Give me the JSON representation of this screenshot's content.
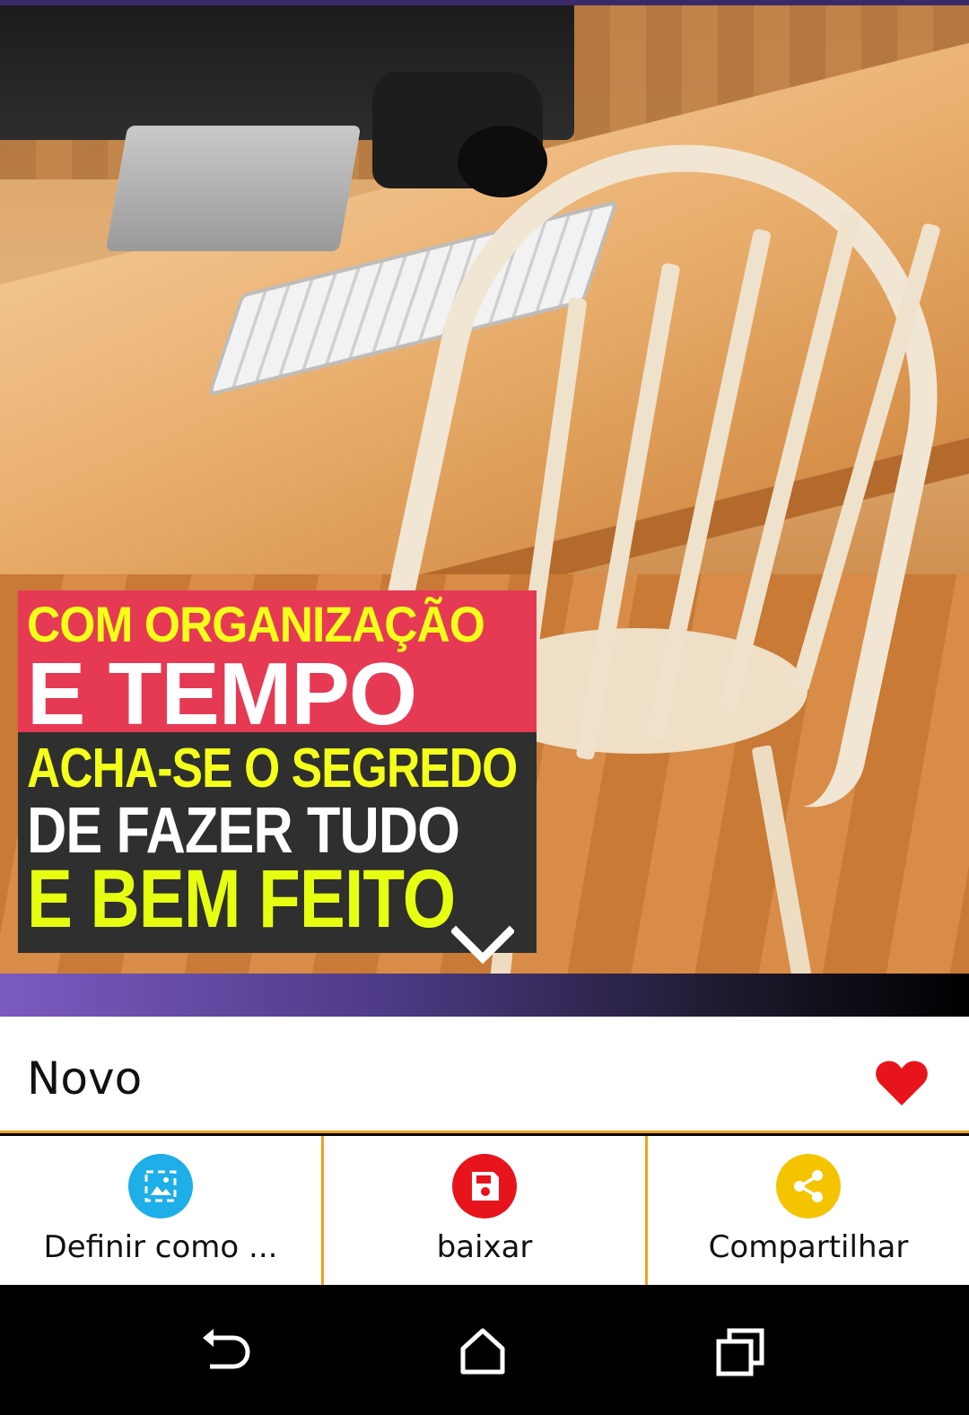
{
  "photo": {
    "quote_lines": [
      "COM ORGANIZAÇÃO",
      "E TEMPO",
      "ACHA-SE O SEGREDO",
      "DE FAZER TUDO",
      "E BEM FEITO"
    ],
    "quote_colors": {
      "top_bg": "#e63a54",
      "bottom_bg": "#2f2f2f",
      "accent": "#f4ff1a"
    }
  },
  "info": {
    "title": "Novo",
    "favorite_color": "#e8141c",
    "divider_color": "#f0a020"
  },
  "actions": [
    {
      "label": "Definir como ...",
      "icon": "wallpaper-icon",
      "color": "#1eaee8"
    },
    {
      "label": "baixar",
      "icon": "save-icon",
      "color": "#e8141c"
    },
    {
      "label": "Compartilhar",
      "icon": "share-icon",
      "color": "#f5c400"
    }
  ],
  "navbar": {
    "buttons": [
      "back-icon",
      "home-icon",
      "recents-icon"
    ]
  }
}
